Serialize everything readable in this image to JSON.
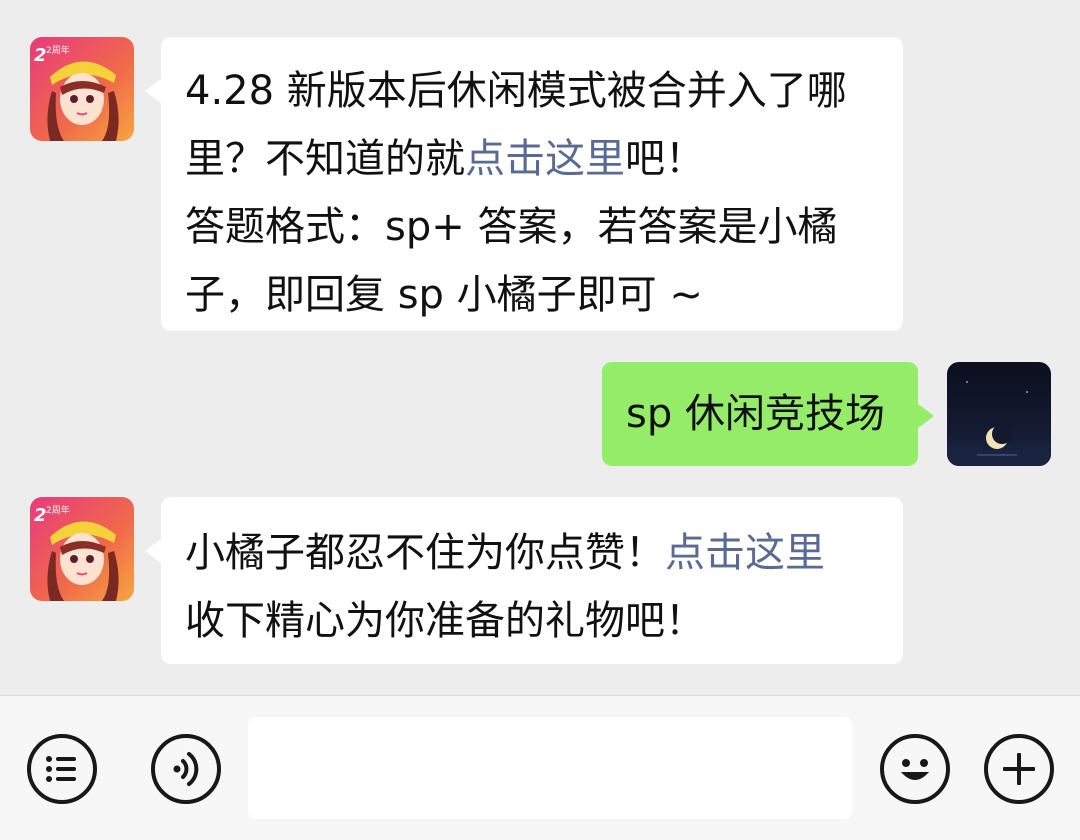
{
  "messages": [
    {
      "direction": "incoming",
      "lines": [
        {
          "text": "4.28 新版本后休闲模式被合并入了哪"
        },
        {
          "before": "里？不知道的就",
          "link": "点击这里",
          "after": "吧！"
        },
        {
          "text": "答题格式：sp+ 答案，若答案是小橘"
        },
        {
          "text": "子，即回复 sp 小橘子即可 ~"
        }
      ]
    },
    {
      "direction": "outgoing",
      "text": "sp 休闲竞技场"
    },
    {
      "direction": "incoming",
      "lines": [
        {
          "before": "小橘子都忍不住为你点赞！",
          "link": "点击这里"
        },
        {
          "text": "收下精心为你准备的礼物吧！"
        }
      ]
    }
  ],
  "avatars": {
    "bot_badge_text": "2周年",
    "bot_label": "bot-avatar",
    "user_label": "user-avatar-moon-night"
  },
  "input_bar": {
    "menu_icon": "list-menu-icon",
    "voice_icon": "voice-icon",
    "input_value": "",
    "emoji_icon": "smiley-icon",
    "plus_icon": "plus-icon"
  },
  "colors": {
    "background": "#ededed",
    "incoming_bubble": "#ffffff",
    "outgoing_bubble": "#95ec69",
    "link": "#576b95",
    "input_bar": "#f7f7f7"
  }
}
